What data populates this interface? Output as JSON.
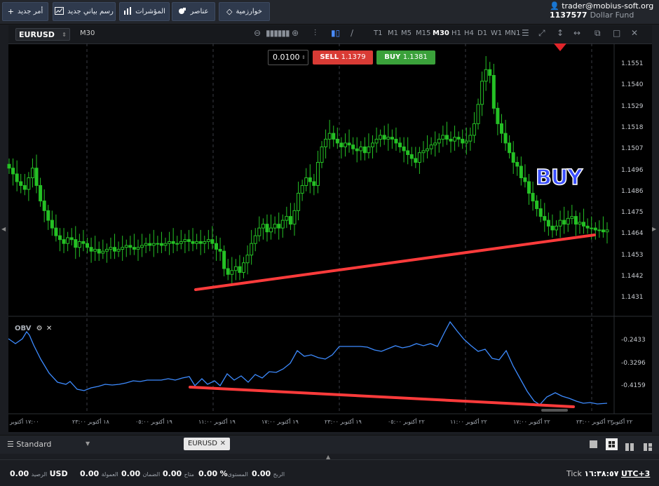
{
  "toolbar_buttons": [
    {
      "label": "أمر جديد",
      "icon": "plus-icon"
    },
    {
      "label": "رسم بياني جديد",
      "icon": "chart-icon"
    },
    {
      "label": "المؤشرات",
      "icon": "bars-icon"
    },
    {
      "label": "عناصر",
      "icon": "shapes-icon"
    },
    {
      "label": "خوارزمية",
      "icon": "diamond-icon"
    }
  ],
  "account": {
    "user": "trader@mobius-soft.org",
    "balance": "1137577",
    "fund": "Dollar Fund"
  },
  "chart": {
    "symbol": "EURUSD",
    "timeframe": "M30",
    "timeframes": [
      "T1",
      "M1",
      "M5",
      "M15",
      "M30",
      "H1",
      "H4",
      "D1",
      "W1",
      "MN1"
    ],
    "active_tf": "M30",
    "lot": "0.0100",
    "sell_label": "SELL",
    "sell_price": "1.1379",
    "buy_label": "BUY",
    "buy_price": "1.1381",
    "annotation": "BUY",
    "indicator": "OBV",
    "price_ticks": [
      "1.1551",
      "1.1540",
      "1.1529",
      "1.1518",
      "1.1507",
      "1.1496",
      "1.1486",
      "1.1475",
      "1.1464",
      "1.1453",
      "1.1442",
      "1.1431"
    ],
    "obv_ticks": [
      "-0.2433",
      "-0.3296",
      "-0.4159"
    ],
    "time_ticks": [
      "١٧:٠٠ أكتوبر",
      "١٨ أكتوبر ٢٣:٠٠",
      "١٩ أكتوبر ٠٥:٠٠",
      "١٩ أكتوبر ١١:٠٠",
      "١٩ أكتوبر ١٧:٠٠",
      "١٩ أكتوبر ٢٣:٠٠",
      "٢٢ أكتوبر ٠٥:٠٠",
      "٢٢ أكتوبر ١١:٠٠",
      "٢٢ أكتوبر ١٧:٠٠",
      "٢٢ أكتوبر ٢٣:٠٠",
      "٢٢ أكتوبر"
    ],
    "colors": {
      "up": "#25c125",
      "down": "#25c125",
      "trend": "#ff3b3b",
      "obv": "#3d8bff"
    }
  },
  "tabs": {
    "layout": "Standard",
    "open_tab": "EURUSD"
  },
  "status": {
    "balance_label": "الرصيد",
    "balance": "0.00",
    "currency": "USD",
    "commission_label": "العمولة",
    "commission": "0.00",
    "margin_label": "الضمان",
    "margin": "0.00",
    "free_label": "متاح",
    "free": "0.00",
    "level_label": "المستوى",
    "level": "0.00",
    "level_unit": "%",
    "profit_label": "الربح",
    "profit": "0.00",
    "clock_label": "Tick",
    "clock": "١٦:٣٨:٥٧",
    "tz": "UTC+3"
  }
}
